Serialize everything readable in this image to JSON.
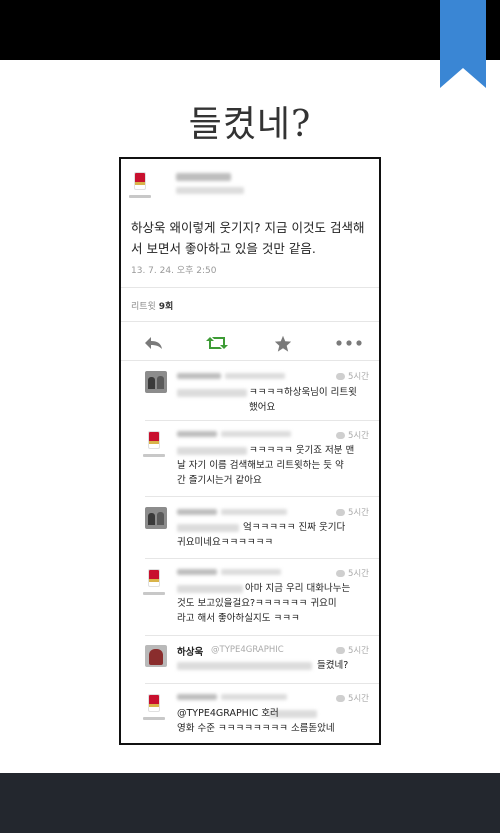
{
  "colors": {
    "top_bar": "#000000",
    "bottom_bar": "#23272e",
    "ribbon": "#3a86d4",
    "retweet_green": "#3d9b35"
  },
  "headline": "들켰네?",
  "main_tweet": {
    "text": "하상욱 왜이렇게 웃기지? 지금 이것도 검색해서 보면서 좋아하고 있을 것만 같음.",
    "timestamp": "13. 7. 24. 오후 2:50",
    "retweet_label": "리트윗",
    "retweet_count": "9회",
    "actions": [
      {
        "name": "reply-icon",
        "glyph": "↩"
      },
      {
        "name": "retweet-icon",
        "glyph": "⇄"
      },
      {
        "name": "favorite-icon",
        "glyph": "★"
      },
      {
        "name": "more-icon",
        "glyph": "•••"
      }
    ]
  },
  "replies": [
    {
      "time": "5시간",
      "text": "ㅋㅋㅋㅋ하상욱님이 리트윗\n했어요"
    },
    {
      "time": "5시간",
      "text": "ㅋㅋㅋㅋㅋ 웃기죠 저분 맨\n날 자기 이름 검색해보고 리트윗하는 듯 약\n간 즐기시는거 같아요"
    },
    {
      "time": "5시간",
      "text": "엌ㅋㅋㅋㅋㅋ 진짜 웃기다\n귀요미네요ㅋㅋㅋㅋㅋㅋ"
    },
    {
      "time": "5시간",
      "text": "아마 지금 우리 대화나누는\n것도 보고있을걸요?ㅋㅋㅋㅋㅋㅋ 귀요미\n라고 해서 좋아하실지도 ㅋㅋㅋ"
    },
    {
      "time": "5시간",
      "name": "하상욱",
      "handle": "@TYPE4GRAPHIC",
      "text": "들켰네?"
    },
    {
      "time": "5시간",
      "text": "@TYPE4GRAPHIC 호러\n영화 수준 ㅋㅋㅋㅋㅋㅋㅋㅋ 소름돋았네"
    }
  ]
}
